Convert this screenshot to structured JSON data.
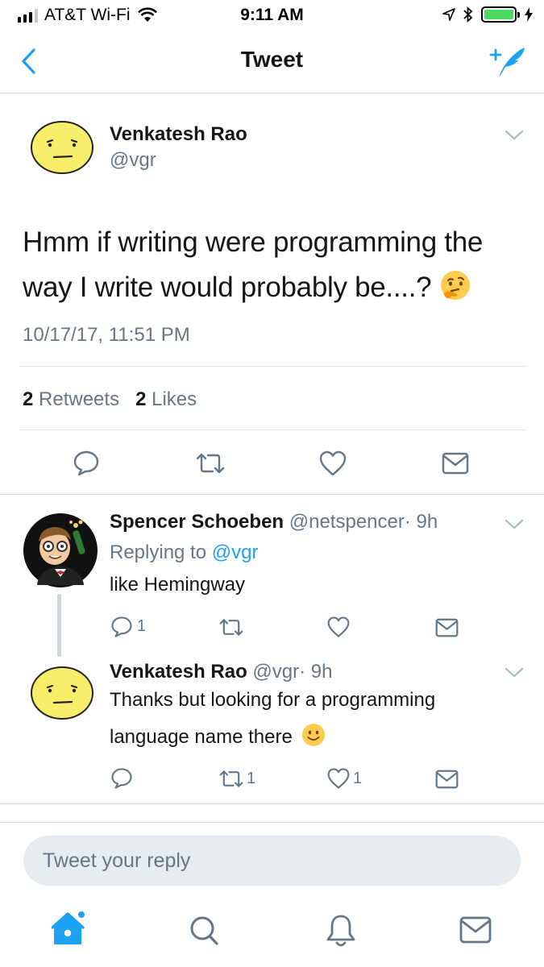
{
  "status_bar": {
    "carrier": "AT&T Wi-Fi",
    "time": "9:11 AM"
  },
  "nav": {
    "title": "Tweet",
    "back_icon": "chevron-left-icon",
    "compose_icon": "compose-tweet-icon"
  },
  "main_tweet": {
    "author_name": "Venkatesh Rao",
    "author_handle": "@vgr",
    "text": "Hmm if writing were programming the way I write would probably be....?",
    "emoji": "thinking-face",
    "timestamp": "10/17/17, 11:51 PM",
    "retweets_count": "2",
    "retweets_label": "Retweets",
    "likes_count": "2",
    "likes_label": "Likes"
  },
  "replies": [
    {
      "name": "Spencer Schoeben",
      "handle": "@netspencer",
      "age": "· 9h",
      "replying_prefix": "Replying to",
      "replying_to": "@vgr",
      "text": "like Hemingway",
      "reply_count": "1",
      "retweet_count": "",
      "like_count": ""
    },
    {
      "name": "Venkatesh Rao",
      "handle": "@vgr",
      "age": "· 9h",
      "text_line1": "Thanks but looking for a programming",
      "text_line2": "language name there",
      "emoji": "slightly-smiling-face",
      "reply_count": "",
      "retweet_count": "1",
      "like_count": "1"
    }
  ],
  "reply_box": {
    "placeholder": "Tweet your reply"
  },
  "tab_bar": [
    "home-icon",
    "search-icon",
    "notifications-bell-icon",
    "messages-envelope-icon"
  ],
  "colors": {
    "accent": "#1da1f2",
    "secondary_text": "#657786",
    "primary_text": "#14171a",
    "battery": "#4cd964"
  }
}
